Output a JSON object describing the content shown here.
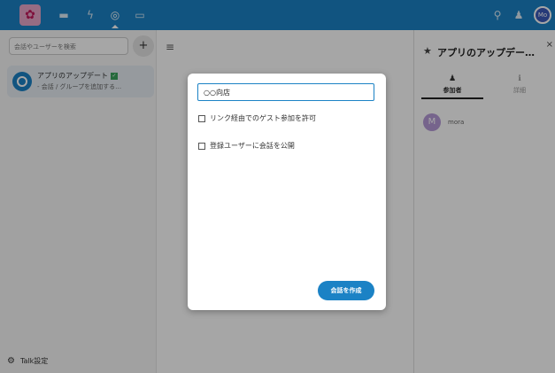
{
  "topbar": {
    "icons": [
      "files-icon",
      "activity-icon",
      "talk-icon",
      "calendar-icon"
    ],
    "search_icon": "search-icon",
    "contacts_icon": "contacts-icon",
    "avatar_text": "Mo",
    "accent": "#1b82c5"
  },
  "sidebar": {
    "search_placeholder": "会話やユーザーを検索",
    "add_label": "+",
    "conversation": {
      "title": "アプリのアップデート",
      "subtitle": "- 会話 / グループを追加する…"
    },
    "settings_label": "Talk設定"
  },
  "right_sidebar": {
    "title": "アプリのアップデー…",
    "close": "×",
    "tabs": [
      {
        "label": "参加者"
      },
      {
        "label": "詳細"
      }
    ],
    "participant": {
      "initial": "M",
      "name": "mora"
    }
  },
  "modal": {
    "input_value": "○○向店",
    "checkbox1_label": "リンク経由でのゲスト参加を許可",
    "checkbox2_label": "登録ユーザーに会話を公開",
    "button_label": "会話を作成"
  }
}
